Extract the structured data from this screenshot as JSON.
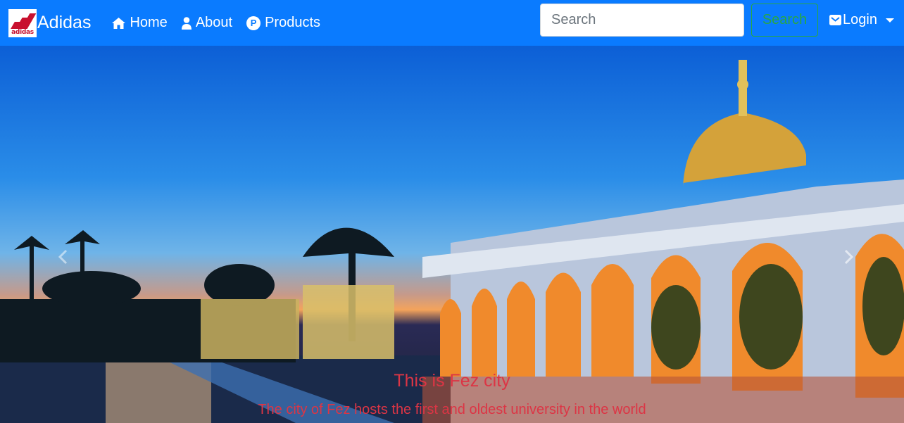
{
  "brand": {
    "name": "Adidas",
    "logo_text": "adidas",
    "logo_color": "#c8102e"
  },
  "nav": {
    "items": [
      {
        "label": "Home",
        "icon": "home-icon"
      },
      {
        "label": "About",
        "icon": "user-icon"
      },
      {
        "label": "Products",
        "icon": "p-circle-icon"
      }
    ]
  },
  "search": {
    "placeholder": "Search",
    "button_label": "Search"
  },
  "login": {
    "label": "Login",
    "icon": "envelope-icon"
  },
  "carousel": {
    "caption_title": "This is Fez city",
    "caption_text": "The city of Fez hosts the first and oldest university in the world",
    "prev_icon": "chevron-left-icon",
    "next_icon": "chevron-right-icon"
  },
  "colors": {
    "navbar": "#0a7bff",
    "search_button": "#28a745",
    "caption": "#dc3545"
  }
}
